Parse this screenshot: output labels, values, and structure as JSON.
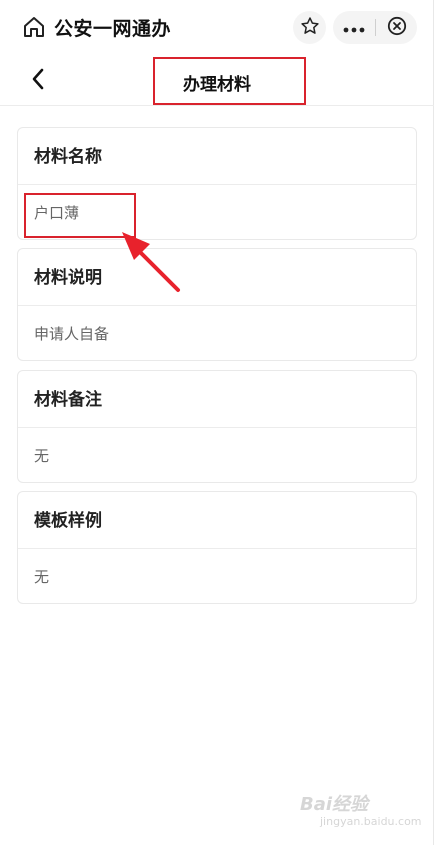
{
  "header": {
    "app_title": "公安一网通办",
    "icons": [
      "home-icon",
      "star-icon",
      "more-icon",
      "close-circle-icon"
    ]
  },
  "nav": {
    "title": "办理材料",
    "back_icon": "chevron-left-icon"
  },
  "cards": [
    {
      "heading": "材料名称",
      "value": "户口薄"
    },
    {
      "heading": "材料说明",
      "value": "申请人自备"
    },
    {
      "heading": "材料备注",
      "value": "无"
    },
    {
      "heading": "模板样例",
      "value": "无"
    }
  ],
  "annotations": {
    "highlight_color": "#d9232d"
  },
  "watermark": {
    "brand": "Bai经验",
    "url": "jingyan.baidu.com"
  }
}
